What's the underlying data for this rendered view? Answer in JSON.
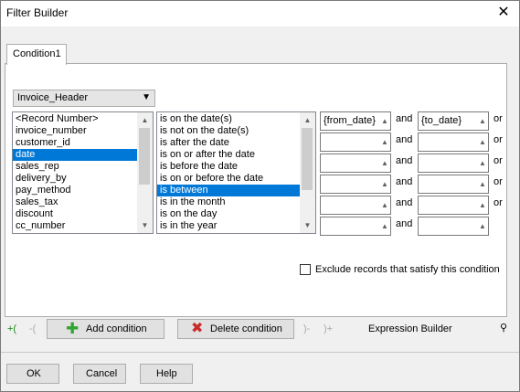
{
  "window": {
    "title": "Filter Builder"
  },
  "tabs": [
    {
      "label": "Condition1"
    }
  ],
  "table_select": {
    "value": "Invoice_Header"
  },
  "fields": [
    "<Record Number>",
    "invoice_number",
    "customer_id",
    "date",
    "sales_rep",
    "delivery_by",
    "pay_method",
    "sales_tax",
    "discount",
    "cc_number"
  ],
  "selected_field": "date",
  "operators": [
    "is on the date(s)",
    "is not on the date(s)",
    "is after the date",
    "is on or after the date",
    "is before the date",
    "is on or before the date",
    "is between",
    "is in the month",
    "is on the day",
    "is in the year"
  ],
  "selected_operator": "is between",
  "value_rows": [
    {
      "from": "{from_date}",
      "and": "and",
      "to": "{to_date}",
      "or": "or"
    },
    {
      "from": "",
      "and": "and",
      "to": "",
      "or": "or"
    },
    {
      "from": "",
      "and": "and",
      "to": "",
      "or": "or"
    },
    {
      "from": "",
      "and": "and",
      "to": "",
      "or": "or"
    },
    {
      "from": "",
      "and": "and",
      "to": "",
      "or": "or"
    },
    {
      "from": "",
      "and": "and",
      "to": "",
      "or": ""
    }
  ],
  "exclude_label": "Exclude records that satisfy this condition",
  "toolbar": {
    "open_paren": "+(",
    "remove_paren": "-(",
    "close_paren": ")-",
    "add_close_paren": ")+",
    "add_condition": "Add condition",
    "delete_condition": "Delete condition",
    "expression_builder": "Expression Builder"
  },
  "buttons": {
    "ok": "OK",
    "cancel": "Cancel",
    "help": "Help"
  },
  "colors": {
    "selection": "#0078d7",
    "add_icon": "#2fa52f",
    "delete_icon": "#c92a2a"
  }
}
